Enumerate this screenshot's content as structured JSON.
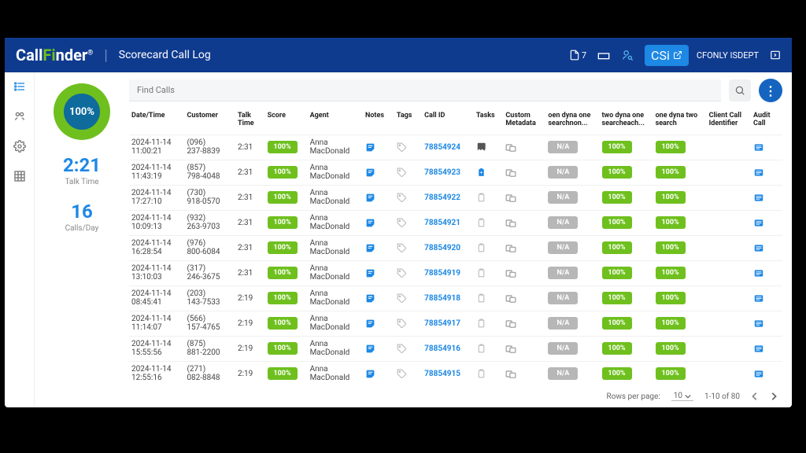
{
  "header": {
    "logo_prefix": "Call",
    "logo_highlight": "Fi",
    "logo_suffix": "nder",
    "logo_mark": "®",
    "title": "Scorecard Call Log",
    "doc_count": "7",
    "csi_label": "CSi",
    "user": "CFONLY ISDEPT"
  },
  "summary": {
    "ring_pct": "100%",
    "talk_time": "2:21",
    "talk_time_label": "Talk Time",
    "calls_day": "16",
    "calls_day_label": "Calls/Day"
  },
  "search": {
    "placeholder": "Find Calls"
  },
  "columns": {
    "datetime": "Date/Time",
    "customer": "Customer",
    "talk": "Talk Time",
    "score": "Score",
    "agent": "Agent",
    "notes": "Notes",
    "tags": "Tags",
    "callid": "Call ID",
    "tasks": "Tasks",
    "custmeta": "Custom Metadata",
    "dyn1": "oen dyna one searchnon...",
    "dyn2": "two dyna one searcheach...",
    "dyn3": "one dyna two search",
    "clientid": "Client Call Identifier",
    "audit": "Audit Call"
  },
  "na_label": "N/A",
  "pct_label": "100%",
  "rows": [
    {
      "date": "2024-11-14",
      "time": "11:00:21",
      "c1": "(096)",
      "c2": "237-8839",
      "talk": "2:31",
      "agent1": "Anna",
      "agent2": "MacDonald",
      "id": "78854924",
      "taskSpecial": "torn"
    },
    {
      "date": "2024-11-14",
      "time": "11:43:19",
      "c1": "(857)",
      "c2": "798-4048",
      "talk": "2:31",
      "agent1": "Anna",
      "agent2": "MacDonald",
      "id": "78854923",
      "taskSpecial": "clip"
    },
    {
      "date": "2024-11-14",
      "time": "17:27:10",
      "c1": "(730)",
      "c2": "918-0570",
      "talk": "2:31",
      "agent1": "Anna",
      "agent2": "MacDonald",
      "id": "78854922",
      "taskSpecial": ""
    },
    {
      "date": "2024-11-14",
      "time": "10:09:13",
      "c1": "(932)",
      "c2": "263-9703",
      "talk": "2:31",
      "agent1": "Anna",
      "agent2": "MacDonald",
      "id": "78854921",
      "taskSpecial": ""
    },
    {
      "date": "2024-11-14",
      "time": "16:28:54",
      "c1": "(976)",
      "c2": "800-6084",
      "talk": "2:31",
      "agent1": "Anna",
      "agent2": "MacDonald",
      "id": "78854920",
      "taskSpecial": ""
    },
    {
      "date": "2024-11-14",
      "time": "13:10:03",
      "c1": "(317)",
      "c2": "246-3675",
      "talk": "2:31",
      "agent1": "Anna",
      "agent2": "MacDonald",
      "id": "78854919",
      "taskSpecial": ""
    },
    {
      "date": "2024-11-14",
      "time": "08:45:41",
      "c1": "(203)",
      "c2": "143-7533",
      "talk": "2:19",
      "agent1": "Anna",
      "agent2": "MacDonald",
      "id": "78854918",
      "taskSpecial": ""
    },
    {
      "date": "2024-11-14",
      "time": "11:14:07",
      "c1": "(566)",
      "c2": "157-4765",
      "talk": "2:19",
      "agent1": "Anna",
      "agent2": "MacDonald",
      "id": "78854917",
      "taskSpecial": ""
    },
    {
      "date": "2024-11-14",
      "time": "15:55:56",
      "c1": "(875)",
      "c2": "881-2200",
      "talk": "2:19",
      "agent1": "Anna",
      "agent2": "MacDonald",
      "id": "78854916",
      "taskSpecial": ""
    },
    {
      "date": "2024-11-14",
      "time": "12:55:16",
      "c1": "(271)",
      "c2": "082-8848",
      "talk": "2:19",
      "agent1": "Anna",
      "agent2": "MacDonald",
      "id": "78854915",
      "taskSpecial": ""
    }
  ],
  "pager": {
    "rpp_label": "Rows per page:",
    "rpp_value": "10",
    "range": "1-10 of 80"
  }
}
